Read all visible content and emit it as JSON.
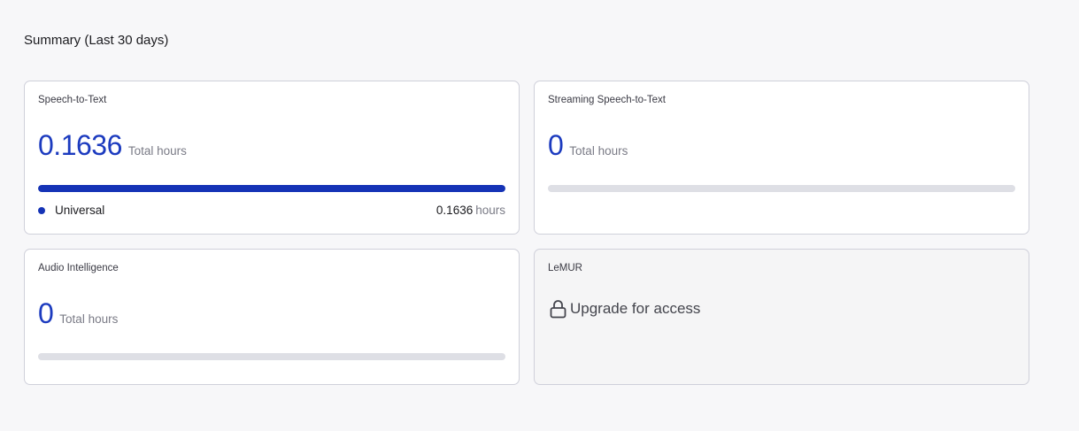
{
  "summary": {
    "title": "Summary (Last 30 days)"
  },
  "cards": {
    "speech_to_text": {
      "title": "Speech-to-Text",
      "value": "0.1636",
      "unit": "Total hours",
      "bar_fill_fraction": 1.0,
      "legend": {
        "label": "Universal",
        "value": "0.1636",
        "unit": "hours"
      }
    },
    "streaming": {
      "title": "Streaming Speech-to-Text",
      "value": "0",
      "unit": "Total hours",
      "bar_fill_fraction": 0
    },
    "audio_intelligence": {
      "title": "Audio Intelligence",
      "value": "0",
      "unit": "Total hours",
      "bar_fill_fraction": 0
    },
    "lemur": {
      "title": "LeMUR",
      "upgrade_text": "Upgrade for access",
      "icon": "lock-icon"
    }
  },
  "colors": {
    "accent": "#1c3bbf",
    "bar_fill": "#1533b6",
    "bar_track": "#dedfe5",
    "card_border": "#cfd0da"
  }
}
